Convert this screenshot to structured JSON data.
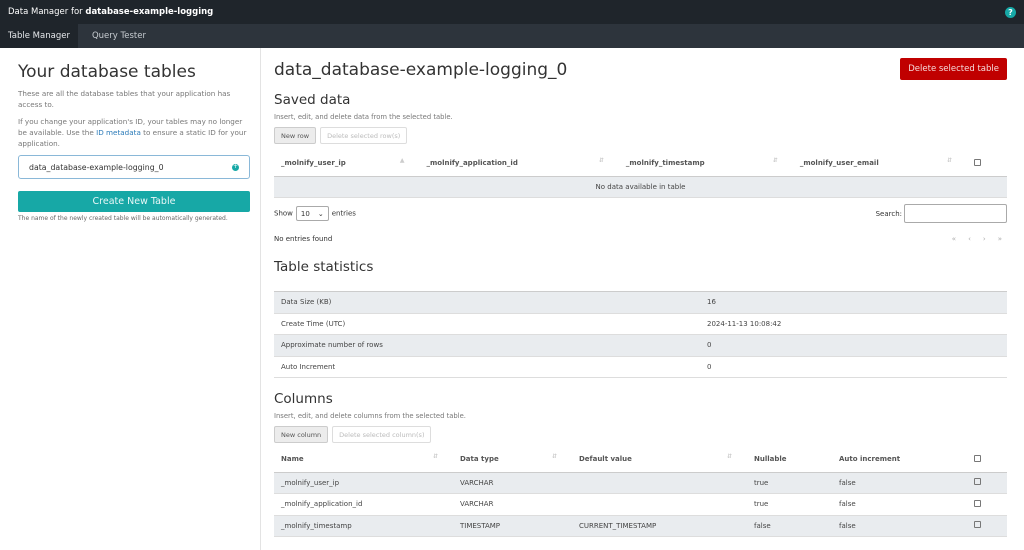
{
  "topbar": {
    "prefix": "Data Manager for ",
    "app_name": "database-example-logging",
    "help_icon": "?"
  },
  "nav": {
    "tabs": [
      {
        "label": "Table Manager",
        "active": true
      },
      {
        "label": "Query Tester",
        "active": false
      }
    ]
  },
  "sidebar": {
    "title": "Your database tables",
    "desc1": "These are all the database tables that your application has access to.",
    "desc2_a": "If you change your application's ID, your tables may no longer be available. Use the ",
    "desc2_link": "ID metadata",
    "desc2_b": " to ensure a static ID for your application.",
    "selected_table": "data_database-example-logging_0",
    "create_label": "Create New Table",
    "create_hint": "The name of the newly created table will be automatically generated."
  },
  "main": {
    "title": "data_database-example-logging_0",
    "delete_table_label": "Delete selected table",
    "saved": {
      "heading": "Saved data",
      "subtitle": "Insert, edit, and delete data from the selected table.",
      "new_row_label": "New row",
      "delete_rows_label": "Delete selected row(s)",
      "columns": [
        "_molnify_user_ip",
        "_molnify_application_id",
        "_molnify_timestamp",
        "_molnify_user_email"
      ],
      "empty_text": "No data available in table",
      "show_label": "Show",
      "page_size": "10",
      "entries_label": "entries",
      "search_label": "Search:",
      "search_value": "",
      "info": "No entries found",
      "pager": [
        "«",
        "‹",
        "›",
        "»"
      ]
    },
    "stats": {
      "heading": "Table statistics",
      "rows": [
        {
          "label": "Data Size (KB)",
          "value": "16"
        },
        {
          "label": "Create Time (UTC)",
          "value": "2024-11-13 10:08:42"
        },
        {
          "label": "Approximate number of rows",
          "value": "0"
        },
        {
          "label": "Auto Increment",
          "value": "0"
        }
      ]
    },
    "columns": {
      "heading": "Columns",
      "subtitle": "Insert, edit, and delete columns from the selected table.",
      "new_column_label": "New column",
      "delete_columns_label": "Delete selected column(s)",
      "headers": [
        "Name",
        "Data type",
        "Default value",
        "Nullable",
        "Auto increment"
      ],
      "rows": [
        {
          "name": "_molnify_user_ip",
          "type": "VARCHAR",
          "default": "",
          "nullable": "true",
          "auto": "false"
        },
        {
          "name": "_molnify_application_id",
          "type": "VARCHAR",
          "default": "",
          "nullable": "true",
          "auto": "false"
        },
        {
          "name": "_molnify_timestamp",
          "type": "TIMESTAMP",
          "default": "CURRENT_TIMESTAMP",
          "nullable": "false",
          "auto": "false"
        }
      ]
    }
  }
}
